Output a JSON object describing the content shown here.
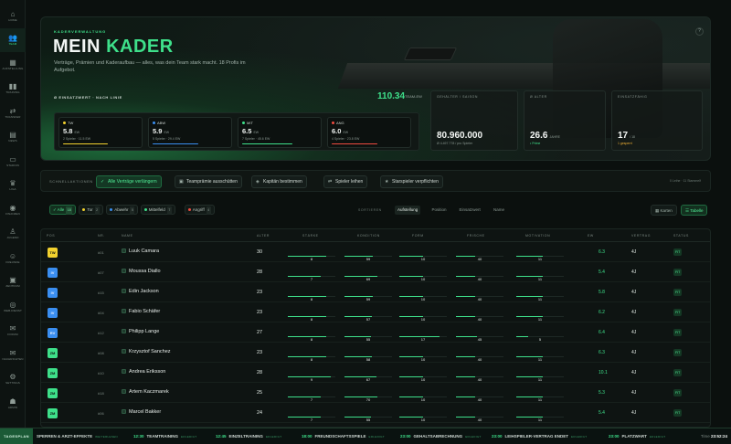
{
  "sidebar": {
    "items": [
      {
        "label": "HOME",
        "icon": "home-icon",
        "glyph": "⌂"
      },
      {
        "label": "TEAM",
        "icon": "team-icon",
        "glyph": "👥",
        "active": true
      },
      {
        "label": "AUFSTELLUNG",
        "icon": "lineup-icon",
        "glyph": "▦"
      },
      {
        "label": "TRAINING",
        "icon": "training-icon",
        "glyph": "▮▮"
      },
      {
        "label": "TRANSFER",
        "icon": "transfer-icon",
        "glyph": "⇄"
      },
      {
        "label": "NEWS",
        "icon": "news-icon",
        "glyph": "▤"
      },
      {
        "label": "STADION",
        "icon": "stadium-icon",
        "glyph": "▭"
      },
      {
        "label": "LIGA",
        "icon": "trophy-icon",
        "glyph": "♛"
      },
      {
        "label": "FINANZEN",
        "icon": "finance-icon",
        "glyph": "◉"
      },
      {
        "label": "JUGEND",
        "icon": "youth-icon",
        "glyph": "♙"
      },
      {
        "label": "FREUNDE",
        "icon": "friends-icon",
        "glyph": "☺"
      },
      {
        "label": "ZENTRUM",
        "icon": "center-icon",
        "glyph": "▣"
      },
      {
        "label": "WEB-DIENST",
        "icon": "globe-icon",
        "glyph": "◎"
      },
      {
        "label": "FORUM",
        "icon": "forum-icon",
        "glyph": "✉"
      },
      {
        "label": "NACHRICHTEN",
        "icon": "messages-icon",
        "glyph": "✉"
      },
      {
        "label": "SETTINGS",
        "icon": "settings-icon",
        "glyph": "⚙"
      },
      {
        "label": "ADMIN",
        "icon": "admin-icon",
        "glyph": "☗"
      }
    ]
  },
  "hero": {
    "kicker": "KADERVERWALTUNG",
    "title_main": "MEIN",
    "title_accent": "KADER",
    "description": "Verträge, Prämien und Kaderaufbau — alles, was dein Team stark macht. 18 Profis im Aufgebot.",
    "help": "?",
    "value_label": "Ø EINSATZWERT · NACH LINIE",
    "value_num": "110.34",
    "value_unit": "TEAM-EW",
    "lines": [
      {
        "tag": "TW",
        "color": "#f2d12e",
        "value": "5.8",
        "unit": "EW",
        "sub": "2 Spieler · 11.5 EW",
        "fill": 0.58
      },
      {
        "tag": "ABW",
        "color": "#3a8ef0",
        "value": "5.9",
        "unit": "EW",
        "sub": "5 Spieler · 29.4 EW",
        "fill": 0.59
      },
      {
        "tag": "MIT",
        "color": "#3ee08a",
        "value": "6.5",
        "unit": "EW",
        "sub": "7 Spieler · 45.6 EW",
        "fill": 0.65
      },
      {
        "tag": "ANG",
        "color": "#ef4b3f",
        "value": "6.0",
        "unit": "EW",
        "sub": "4 Spieler · 23.8 EW",
        "fill": 0.6
      }
    ],
    "stats": [
      {
        "label": "GEHÄLTER / SAISON",
        "value": "80.960.000",
        "unit": "",
        "sub": "Ø 4.497.778 / pro Spieler",
        "sub_color": "#8a9892"
      },
      {
        "label": "Ø ALTER",
        "value": "26.6",
        "unit": "JAHRE",
        "sub": "• Prime",
        "sub_color": "#3ee08a"
      },
      {
        "label": "EINSATZFÄHIG",
        "value": "17",
        "unit": "/ 18",
        "sub": "1 gesperrt",
        "sub_color": "#f2b134"
      }
    ]
  },
  "quick": {
    "label": "SCHNELLAKTIONEN",
    "buttons": [
      {
        "label": "Alle Verträge verlängern",
        "icon": "check-circle-icon",
        "glyph": "✓",
        "primary": true
      },
      {
        "label": "Teamprämie ausschütten",
        "icon": "money-icon",
        "glyph": "▣"
      },
      {
        "label": "Kapitän bestimmen",
        "icon": "captain-icon",
        "glyph": "◈"
      },
      {
        "label": "Spieler leihen",
        "icon": "swap-icon",
        "glyph": "⇄"
      },
      {
        "label": "Starspieler verpflichten",
        "icon": "star-icon",
        "glyph": "★"
      }
    ],
    "status": "0 Leihe · 11 Stammelf"
  },
  "filters": {
    "chips": [
      {
        "label": "Alle",
        "count": "18",
        "active": true
      },
      {
        "label": "Tor",
        "count": "2",
        "color": "#f2d12e"
      },
      {
        "label": "Abwehr",
        "count": "5",
        "color": "#3a8ef0"
      },
      {
        "label": "Mittelfeld",
        "count": "7",
        "color": "#3ee08a"
      },
      {
        "label": "Angriff",
        "count": "4",
        "color": "#ef4b3f"
      }
    ],
    "sort_label": "SORTIEREN",
    "sorts": [
      {
        "label": "Aufstellung",
        "active": true
      },
      {
        "label": "Position"
      },
      {
        "label": "Einsatzwert"
      },
      {
        "label": "Name"
      }
    ],
    "views": [
      {
        "label": "Karten",
        "icon": "grid-icon",
        "glyph": "▦"
      },
      {
        "label": "Tabelle",
        "icon": "table-icon",
        "glyph": "☰",
        "active": true
      }
    ]
  },
  "table": {
    "columns": [
      "POS",
      "NR.",
      "NAME",
      "ALTER",
      "STÄRKE",
      "KONDITION",
      "FORM",
      "FRISCHE",
      "MOTIVATION",
      "EW",
      "VERTRAG",
      "STATUS"
    ],
    "rows": [
      {
        "pos": "TW",
        "pos_color": "#f2d12e",
        "nr": "#01",
        "name": "Luuk Camara",
        "age": "30",
        "staerke": "8",
        "kondition": "59",
        "form": "10",
        "frische": "40",
        "motivation": "11",
        "ew": "6.3",
        "vertrag": "4J",
        "status": "FIT"
      },
      {
        "pos": "IV",
        "pos_color": "#3a8ef0",
        "nr": "#07",
        "name": "Moussa Diallo",
        "age": "28",
        "staerke": "7",
        "kondition": "69",
        "form": "10",
        "frische": "40",
        "motivation": "11",
        "ew": "5.4",
        "vertrag": "4J",
        "status": "FIT"
      },
      {
        "pos": "IV",
        "pos_color": "#3a8ef0",
        "nr": "#15",
        "name": "Edin Jackson",
        "age": "23",
        "staerke": "8",
        "kondition": "59",
        "form": "10",
        "frische": "40",
        "motivation": "11",
        "ew": "5.8",
        "vertrag": "4J",
        "status": "FIT"
      },
      {
        "pos": "IV",
        "pos_color": "#3a8ef0",
        "nr": "#04",
        "name": "Fabio Schäfer",
        "age": "23",
        "staerke": "8",
        "kondition": "57",
        "form": "10",
        "frische": "40",
        "motivation": "11",
        "ew": "6.2",
        "vertrag": "4J",
        "status": "FIT"
      },
      {
        "pos": "RV",
        "pos_color": "#3a8ef0",
        "nr": "#12",
        "name": "Philipp Lange",
        "age": "27",
        "staerke": "8",
        "kondition": "55",
        "form": "17",
        "frische": "45",
        "motivation": "5",
        "ew": "6.4",
        "vertrag": "4J",
        "status": "FIT"
      },
      {
        "pos": "ZM",
        "pos_color": "#3ee08a",
        "nr": "#08",
        "name": "Krzysztof Sanchez",
        "age": "23",
        "staerke": "8",
        "kondition": "58",
        "form": "10",
        "frische": "40",
        "motivation": "11",
        "ew": "6.3",
        "vertrag": "4J",
        "status": "FIT"
      },
      {
        "pos": "ZM",
        "pos_color": "#3ee08a",
        "nr": "#10",
        "name": "Andrea Eriksson",
        "age": "28",
        "staerke": "9",
        "kondition": "67",
        "form": "10",
        "frische": "40",
        "motivation": "11",
        "ew": "10.1",
        "vertrag": "4J",
        "status": "FIT"
      },
      {
        "pos": "ZM",
        "pos_color": "#3ee08a",
        "nr": "#18",
        "name": "Artem Kaczmarek",
        "age": "25",
        "staerke": "7",
        "kondition": "70",
        "form": "10",
        "frische": "40",
        "motivation": "11",
        "ew": "5.3",
        "vertrag": "4J",
        "status": "FIT"
      },
      {
        "pos": "ZM",
        "pos_color": "#3ee08a",
        "nr": "#06",
        "name": "Marcel Bakker",
        "age": "24",
        "staerke": "7",
        "kondition": "55",
        "form": "10",
        "frische": "40",
        "motivation": "11",
        "ew": "5.4",
        "vertrag": "4J",
        "status": "FIT"
      }
    ]
  },
  "ticker": {
    "label": "TAGESPLAN",
    "items": [
      {
        "time": "",
        "event": "SPERREN & ARZT-EFFEKTE",
        "badge": "WEITERLESEN"
      },
      {
        "time": "12:30",
        "event": "TEAMTRAINING",
        "badge": "ERLEDIGT"
      },
      {
        "time": "12:45",
        "event": "EINZELTRAINING",
        "badge": "ERLEDIGT"
      },
      {
        "time": "18:00",
        "event": "FREUNDSCHAFTSSPIELE",
        "badge": "ERLEDIGT"
      },
      {
        "time": "23:00",
        "event": "GEHALTSABRECHNUNG",
        "badge": "ERLEDIGT"
      },
      {
        "time": "23:00",
        "event": "LEIHSPIELER-VERTRAG ENDET",
        "badge": "ERLEDIGT"
      },
      {
        "time": "23:00",
        "event": "PLATZWART",
        "badge": "ERLEDIGT"
      }
    ],
    "clock_label": "Time",
    "clock_value": "23:52:24"
  }
}
